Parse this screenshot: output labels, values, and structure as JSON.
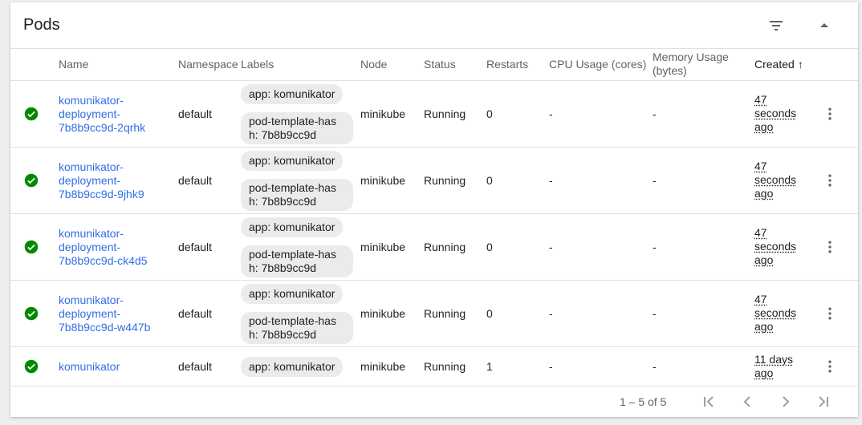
{
  "card": {
    "title": "Pods"
  },
  "header_icons": {
    "filter": "filter-list-icon",
    "collapse": "arrow-up-icon"
  },
  "columns": {
    "name": "Name",
    "namespace": "Namespace",
    "labels": "Labels",
    "node": "Node",
    "status": "Status",
    "restarts": "Restarts",
    "cpu": "CPU Usage (cores)",
    "memory_line1": "Memory Usage",
    "memory_line2": "(bytes)",
    "created": "Created",
    "created_sort": "↑"
  },
  "rows": [
    {
      "name_parts": [
        "komunikator-",
        "deployment-",
        "7b8b9cc9d-2qrhk"
      ],
      "namespace": "default",
      "label_app": "app: komunikator",
      "label_hash_1": "pod-template-has",
      "label_hash_2": "h: 7b8b9cc9d",
      "node": "minikube",
      "status": "Running",
      "restarts": "0",
      "cpu": "-",
      "memory": "-",
      "created": [
        "47",
        "seconds",
        "ago"
      ]
    },
    {
      "name_parts": [
        "komunikator-",
        "deployment-",
        "7b8b9cc9d-9jhk9"
      ],
      "namespace": "default",
      "label_app": "app: komunikator",
      "label_hash_1": "pod-template-has",
      "label_hash_2": "h: 7b8b9cc9d",
      "node": "minikube",
      "status": "Running",
      "restarts": "0",
      "cpu": "-",
      "memory": "-",
      "created": [
        "47",
        "seconds",
        "ago"
      ]
    },
    {
      "name_parts": [
        "komunikator-",
        "deployment-",
        "7b8b9cc9d-ck4d5"
      ],
      "namespace": "default",
      "label_app": "app: komunikator",
      "label_hash_1": "pod-template-has",
      "label_hash_2": "h: 7b8b9cc9d",
      "node": "minikube",
      "status": "Running",
      "restarts": "0",
      "cpu": "-",
      "memory": "-",
      "created": [
        "47",
        "seconds",
        "ago"
      ]
    },
    {
      "name_parts": [
        "komunikator-",
        "deployment-",
        "7b8b9cc9d-w447b"
      ],
      "namespace": "default",
      "label_app": "app: komunikator",
      "label_hash_1": "pod-template-has",
      "label_hash_2": "h: 7b8b9cc9d",
      "node": "minikube",
      "status": "Running",
      "restarts": "0",
      "cpu": "-",
      "memory": "-",
      "created": [
        "47",
        "seconds",
        "ago"
      ]
    },
    {
      "name": "komunikator",
      "namespace": "default",
      "label_app": "app: komunikator",
      "node": "minikube",
      "status": "Running",
      "restarts": "1",
      "cpu": "-",
      "memory": "-",
      "created": [
        "11 days",
        "ago"
      ]
    }
  ],
  "pagination": {
    "range": "1 – 5 of 5",
    "icons": [
      "first-page-icon",
      "previous-page-icon",
      "next-page-icon",
      "last-page-icon"
    ]
  },
  "colors": {
    "link": "#326de6",
    "status_ok": "#008a00",
    "chip": "#ebebeb"
  }
}
